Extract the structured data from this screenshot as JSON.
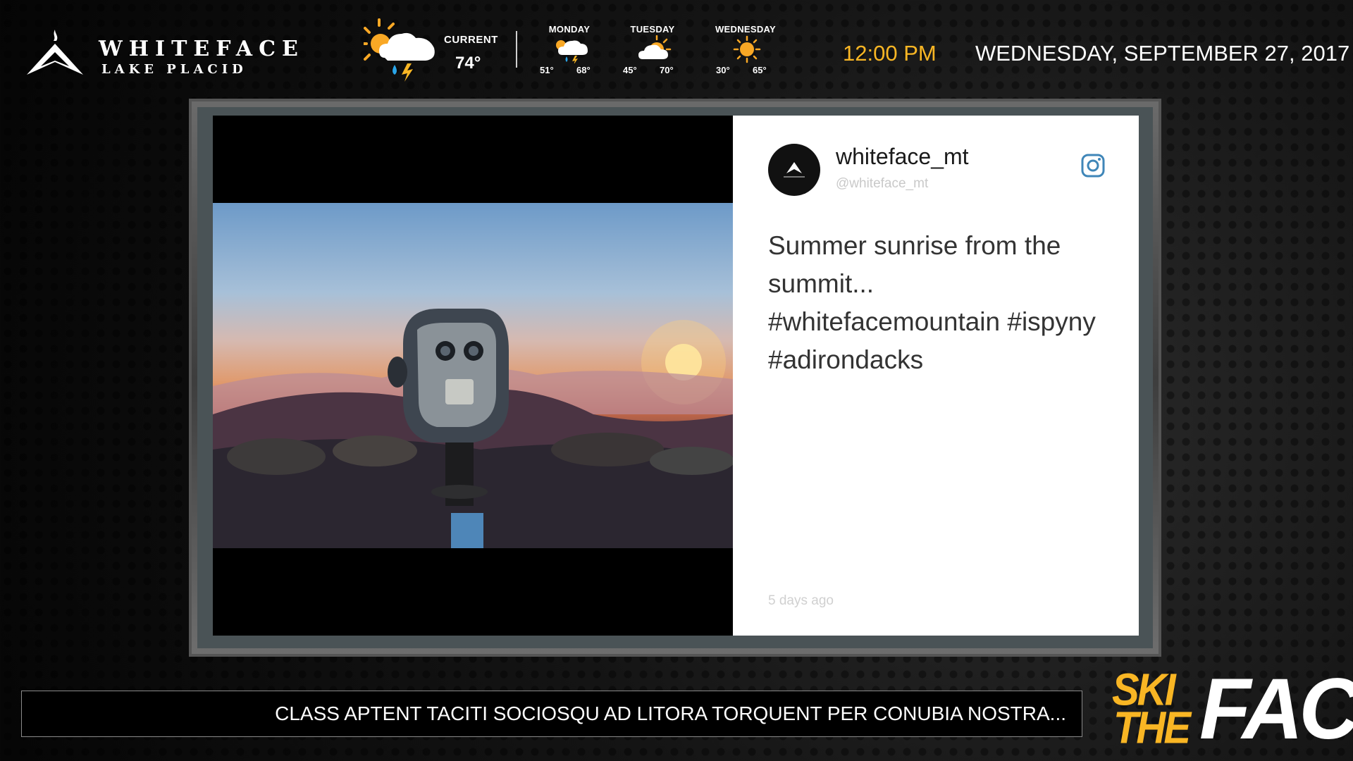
{
  "brand": {
    "name": "WHITEFACE",
    "location": "LAKE PLACID",
    "logo_icon": "whiteface-mountain-logo"
  },
  "weather": {
    "current": {
      "label": "CURRENT",
      "temp": "74°",
      "icon": "sun-cloud-rain-lightning-icon"
    },
    "forecast": [
      {
        "day": "MONDAY",
        "low": "51°",
        "high": "68°",
        "icon": "cloud-rain-lightning-icon"
      },
      {
        "day": "TUESDAY",
        "low": "45°",
        "high": "70°",
        "icon": "partly-cloudy-icon"
      },
      {
        "day": "WEDNESDAY",
        "low": "30°",
        "high": "65°",
        "icon": "sun-icon"
      }
    ]
  },
  "clock": {
    "time": "12:00 PM",
    "date": "WEDNESDAY,  SEPTEMBER 27, 2017"
  },
  "post": {
    "username": "whiteface_mt",
    "handle": "@whiteface_mt",
    "text": "Summer sunrise from the summit... #whitefacemountain #ispyny #adirondacks",
    "time_ago": "5 days ago",
    "platform_icon": "instagram-icon",
    "image": "summit-binocular-viewer-sunrise-photo"
  },
  "ticker": {
    "text": "CLASS APTENT TACITI SOCIOSQU AD LITORA TORQUENT PER CONUBIA NOSTRA..."
  },
  "promo": {
    "line1": "SKI",
    "line2": "THE",
    "line3": "FACE"
  },
  "colors": {
    "accent": "#f9b624",
    "background": "#111111",
    "card": "#ffffff"
  }
}
